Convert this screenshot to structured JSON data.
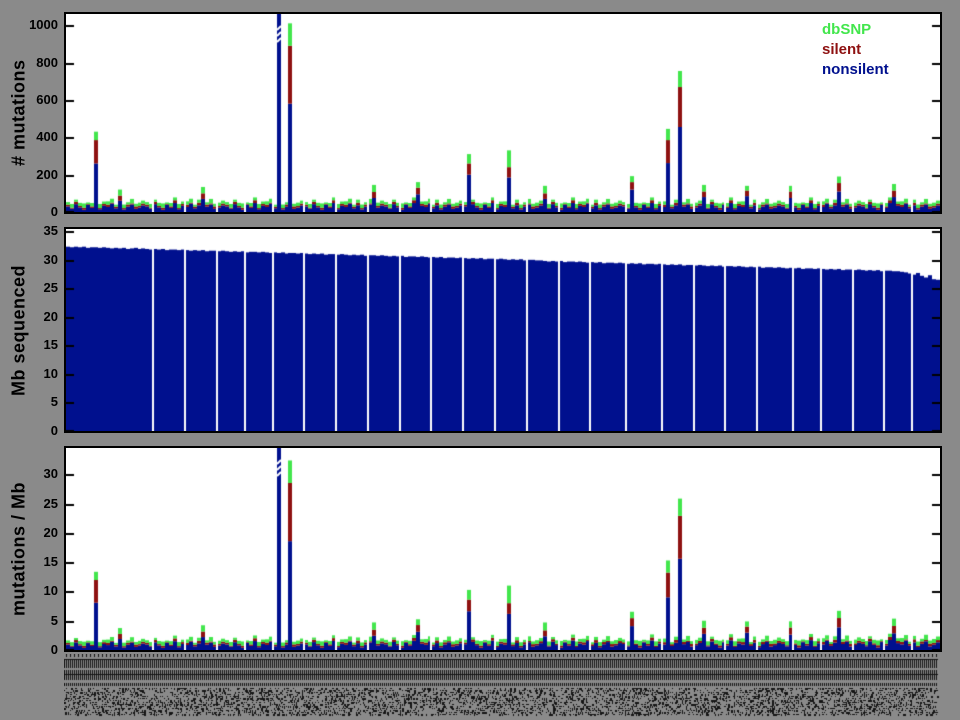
{
  "figure": {
    "background": "#8a8a8a",
    "panel_bg": "#ffffff",
    "axis_color": "#000000"
  },
  "legend": {
    "position": "top-right-inside-first-panel",
    "items": [
      {
        "label": "dbSNP",
        "color": "#42e64c"
      },
      {
        "label": "silent",
        "color": "#8e1111"
      },
      {
        "label": "nonsilent",
        "color": "#00108e"
      }
    ]
  },
  "panels": [
    {
      "ylabel": "# mutations",
      "yticks": [
        0,
        200,
        400,
        600,
        800,
        1000
      ],
      "ylim": [
        0,
        1060
      ]
    },
    {
      "ylabel": "Mb sequenced",
      "yticks": [
        0,
        5,
        10,
        15,
        20,
        25,
        30,
        35
      ],
      "ylim": [
        0,
        35.4
      ]
    },
    {
      "ylabel": "mutations / Mb",
      "yticks": [
        0,
        5,
        10,
        15,
        20,
        25,
        30
      ],
      "ylim": [
        0,
        34.5
      ]
    }
  ],
  "xaxis": {
    "description": "one vertical sample label per bar, illegible at this resolution",
    "labels_legible": false
  },
  "chart_data": {
    "type": "bar",
    "subtype": "three stacked-bar panels sharing one sample axis; panel1 = stacked mutation counts, panel2 = Mb sequenced per sample, panel3 = panel1 values divided by Mb",
    "n_samples": 220,
    "bar_colors": {
      "nonsilent": "#00108e",
      "silent": "#8e1111",
      "dbSNP": "#42e64c"
    },
    "stack_order_bottom_to_top": [
      "nonsilent",
      "silent",
      "dbSNP"
    ],
    "truncated_samples": [
      53
    ],
    "separator_indices": [
      22,
      30,
      38,
      45,
      52,
      60,
      68,
      76,
      84,
      92,
      100,
      108,
      116,
      124,
      132,
      141,
      150,
      158,
      166,
      174,
      183,
      190,
      198,
      206,
      213
    ],
    "series": [
      {
        "name": "nonsilent",
        "values": [
          30,
          18,
          42,
          25,
          12,
          38,
          22,
          260,
          15,
          33,
          27,
          45,
          20,
          60,
          14,
          29,
          40,
          17,
          24,
          35,
          30,
          18,
          42,
          25,
          12,
          38,
          22,
          48,
          15,
          33,
          27,
          45,
          20,
          36,
          70,
          29,
          40,
          17,
          24,
          35,
          30,
          18,
          42,
          25,
          12,
          38,
          22,
          48,
          15,
          33,
          27,
          45,
          20,
          2600,
          14,
          29,
          580,
          17,
          24,
          35,
          30,
          18,
          42,
          25,
          12,
          38,
          22,
          48,
          15,
          33,
          27,
          45,
          20,
          36,
          14,
          29,
          40,
          75,
          24,
          35,
          30,
          18,
          42,
          25,
          12,
          38,
          22,
          48,
          95,
          33,
          27,
          45,
          20,
          36,
          14,
          29,
          40,
          17,
          24,
          35,
          30,
          200,
          42,
          25,
          12,
          38,
          22,
          48,
          15,
          33,
          27,
          185,
          20,
          36,
          14,
          29,
          40,
          17,
          24,
          35,
          70,
          18,
          42,
          25,
          12,
          38,
          22,
          48,
          15,
          33,
          27,
          45,
          20,
          36,
          14,
          29,
          40,
          17,
          24,
          35,
          30,
          18,
          120,
          25,
          12,
          38,
          22,
          48,
          15,
          33,
          27,
          262,
          20,
          36,
          455,
          29,
          40,
          17,
          24,
          35,
          80,
          18,
          42,
          25,
          12,
          38,
          22,
          48,
          15,
          33,
          27,
          85,
          20,
          36,
          14,
          29,
          40,
          17,
          24,
          35,
          30,
          18,
          75,
          25,
          12,
          38,
          22,
          48,
          15,
          33,
          27,
          45,
          20,
          36,
          110,
          29,
          40,
          17,
          24,
          35,
          30,
          18,
          42,
          25,
          12,
          38,
          22,
          48,
          80,
          33,
          27,
          45,
          20,
          36,
          14,
          29,
          40,
          17,
          24,
          35
        ]
      },
      {
        "name": "silent",
        "values": [
          9,
          5,
          13,
          7,
          11,
          4,
          8,
          125,
          6,
          10,
          12,
          5,
          9,
          28,
          7,
          11,
          6,
          13,
          8,
          10,
          9,
          5,
          13,
          7,
          11,
          4,
          8,
          15,
          6,
          10,
          12,
          5,
          9,
          14,
          30,
          11,
          6,
          13,
          8,
          10,
          9,
          5,
          13,
          7,
          11,
          4,
          8,
          15,
          6,
          10,
          12,
          5,
          9,
          0,
          7,
          11,
          310,
          13,
          8,
          10,
          9,
          5,
          13,
          7,
          11,
          4,
          8,
          15,
          6,
          10,
          12,
          5,
          9,
          14,
          7,
          11,
          6,
          32,
          8,
          10,
          9,
          5,
          13,
          7,
          11,
          4,
          8,
          15,
          35,
          10,
          12,
          5,
          9,
          14,
          7,
          11,
          6,
          13,
          8,
          10,
          9,
          60,
          13,
          7,
          11,
          4,
          8,
          15,
          6,
          10,
          12,
          55,
          9,
          14,
          7,
          11,
          6,
          13,
          8,
          10,
          30,
          5,
          13,
          7,
          11,
          4,
          8,
          15,
          6,
          10,
          12,
          5,
          9,
          14,
          7,
          11,
          6,
          13,
          8,
          10,
          9,
          5,
          40,
          7,
          11,
          4,
          8,
          15,
          6,
          10,
          12,
          123,
          9,
          14,
          214,
          11,
          6,
          13,
          8,
          10,
          30,
          5,
          13,
          7,
          11,
          4,
          8,
          15,
          6,
          10,
          12,
          30,
          9,
          14,
          7,
          11,
          6,
          13,
          8,
          10,
          9,
          5,
          35,
          7,
          11,
          4,
          8,
          15,
          6,
          10,
          12,
          5,
          9,
          14,
          45,
          11,
          6,
          13,
          8,
          10,
          9,
          5,
          13,
          7,
          11,
          4,
          8,
          15,
          35,
          10,
          12,
          5,
          9,
          14,
          7,
          11,
          6,
          13,
          8,
          10
        ]
      },
      {
        "name": "dbSNP",
        "values": [
          14,
          20,
          11,
          17,
          23,
          9,
          18,
          45,
          22,
          13,
          18,
          21,
          10,
          32,
          19,
          12,
          24,
          14,
          18,
          16,
          14,
          20,
          11,
          17,
          23,
          9,
          18,
          15,
          22,
          13,
          18,
          21,
          10,
          16,
          34,
          12,
          24,
          14,
          18,
          16,
          14,
          20,
          11,
          17,
          23,
          9,
          18,
          15,
          22,
          13,
          18,
          21,
          10,
          0,
          19,
          12,
          120,
          14,
          18,
          16,
          14,
          20,
          11,
          17,
          23,
          9,
          18,
          15,
          22,
          13,
          18,
          21,
          10,
          16,
          19,
          12,
          24,
          38,
          18,
          16,
          14,
          20,
          11,
          17,
          23,
          9,
          18,
          15,
          30,
          13,
          18,
          21,
          10,
          16,
          19,
          12,
          24,
          14,
          18,
          16,
          14,
          50,
          11,
          17,
          23,
          9,
          18,
          15,
          22,
          13,
          18,
          90,
          10,
          16,
          19,
          12,
          24,
          14,
          18,
          16,
          40,
          20,
          11,
          17,
          23,
          9,
          18,
          15,
          22,
          13,
          18,
          21,
          10,
          16,
          19,
          12,
          24,
          14,
          18,
          16,
          14,
          20,
          32,
          17,
          23,
          9,
          18,
          15,
          22,
          13,
          18,
          60,
          10,
          16,
          86,
          12,
          24,
          14,
          18,
          16,
          35,
          20,
          11,
          17,
          23,
          9,
          18,
          15,
          22,
          13,
          18,
          25,
          10,
          16,
          19,
          12,
          24,
          14,
          18,
          16,
          14,
          20,
          30,
          17,
          23,
          9,
          18,
          15,
          22,
          13,
          18,
          21,
          10,
          16,
          35,
          12,
          24,
          14,
          18,
          16,
          14,
          20,
          11,
          17,
          23,
          9,
          18,
          15,
          35,
          13,
          18,
          21,
          10,
          16,
          19,
          12,
          24,
          14,
          18,
          16
        ]
      }
    ],
    "mb_sequenced": [
      32.3,
      32.2,
      32.3,
      32.2,
      32.3,
      32.1,
      32.2,
      32.2,
      32.1,
      32.2,
      32.1,
      32.0,
      32.1,
      32.0,
      32.1,
      31.9,
      32.0,
      32.1,
      31.9,
      32.0,
      31.9,
      31.8,
      31.9,
      31.8,
      31.9,
      31.7,
      31.8,
      31.8,
      31.7,
      31.8,
      31.7,
      31.6,
      31.7,
      31.6,
      31.7,
      31.5,
      31.6,
      31.6,
      31.5,
      31.6,
      31.5,
      31.4,
      31.5,
      31.4,
      31.5,
      31.3,
      31.4,
      31.4,
      31.3,
      31.4,
      31.3,
      31.2,
      31.3,
      31.2,
      31.3,
      31.1,
      31.2,
      31.2,
      31.1,
      31.2,
      31.1,
      31.0,
      31.1,
      31.0,
      31.1,
      30.9,
      31.0,
      31.0,
      30.9,
      31.0,
      30.9,
      30.8,
      30.9,
      30.8,
      30.9,
      30.7,
      30.8,
      30.8,
      30.7,
      30.8,
      30.7,
      30.6,
      30.7,
      30.6,
      30.7,
      30.5,
      30.6,
      30.6,
      30.5,
      30.6,
      30.5,
      30.4,
      30.5,
      30.4,
      30.5,
      30.3,
      30.4,
      30.4,
      30.3,
      30.4,
      30.3,
      30.2,
      30.3,
      30.2,
      30.3,
      30.1,
      30.2,
      30.2,
      30.1,
      30.2,
      30.1,
      30.0,
      30.1,
      30.0,
      30.1,
      29.9,
      30.0,
      30.0,
      29.9,
      29.9,
      29.8,
      29.7,
      29.8,
      29.7,
      29.8,
      29.6,
      29.7,
      29.7,
      29.6,
      29.7,
      29.6,
      29.5,
      29.6,
      29.5,
      29.6,
      29.4,
      29.5,
      29.5,
      29.4,
      29.5,
      29.4,
      29.3,
      29.4,
      29.3,
      29.4,
      29.2,
      29.3,
      29.3,
      29.2,
      29.3,
      29.2,
      29.1,
      29.2,
      29.1,
      29.2,
      29.0,
      29.1,
      29.1,
      29.0,
      29.1,
      29.0,
      28.9,
      29.0,
      28.9,
      29.0,
      28.8,
      28.9,
      28.9,
      28.8,
      28.9,
      28.8,
      28.7,
      28.8,
      28.7,
      28.8,
      28.6,
      28.7,
      28.7,
      28.6,
      28.7,
      28.6,
      28.5,
      28.6,
      28.5,
      28.6,
      28.4,
      28.5,
      28.5,
      28.4,
      28.5,
      28.4,
      28.3,
      28.4,
      28.3,
      28.4,
      28.2,
      28.3,
      28.3,
      28.2,
      28.3,
      28.2,
      28.1,
      28.2,
      28.1,
      28.2,
      28.0,
      28.1,
      28.1,
      28.0,
      28.0,
      27.9,
      27.8,
      27.6,
      27.4,
      27.7,
      27.2,
      26.9,
      27.3,
      26.6,
      26.5
    ]
  }
}
